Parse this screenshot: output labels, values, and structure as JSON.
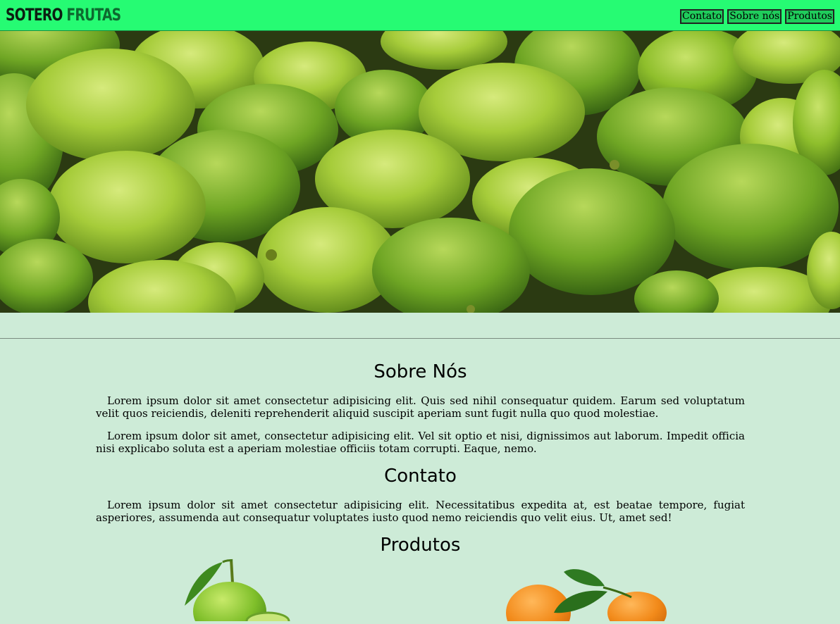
{
  "header": {
    "logo_part1": "SOTERO",
    "logo_part2": "FRUTAS",
    "nav": [
      "Contato",
      "Sobre nós",
      "Produtos"
    ]
  },
  "hero": {
    "image": "limes-photo"
  },
  "sections": {
    "sobre": {
      "title": "Sobre Nós",
      "paragraphs": [
        "Lorem ipsum dolor sit amet consectetur adipisicing elit. Quis sed nihil consequatur quidem. Earum sed voluptatum velit quos reiciendis, deleniti reprehenderit aliquid suscipit aperiam sunt fugit nulla quo quod molestiae.",
        "Lorem ipsum dolor sit amet, consectetur adipisicing elit. Vel sit optio et nisi, dignissimos aut laborum. Impedit officia nisi explicabo soluta est a aperiam molestiae officiis totam corrupti. Eaque, nemo."
      ]
    },
    "contato": {
      "title": "Contato",
      "paragraphs": [
        "Lorem ipsum dolor sit amet consectetur adipisicing elit. Necessitatibus expedita at, est beatae tempore, fugiat asperiores, assumenda aut consequatur voluptates iusto quod nemo reiciendis quo velit eius. Ut, amet sed!"
      ]
    },
    "produtos": {
      "title": "Produtos",
      "items": [
        "lime-product-image",
        "orange-product-image"
      ]
    }
  },
  "colors": {
    "header_bg": "#26fb73",
    "page_bg": "#cdebd7",
    "nav_button_bg": "#1fcc5b"
  }
}
